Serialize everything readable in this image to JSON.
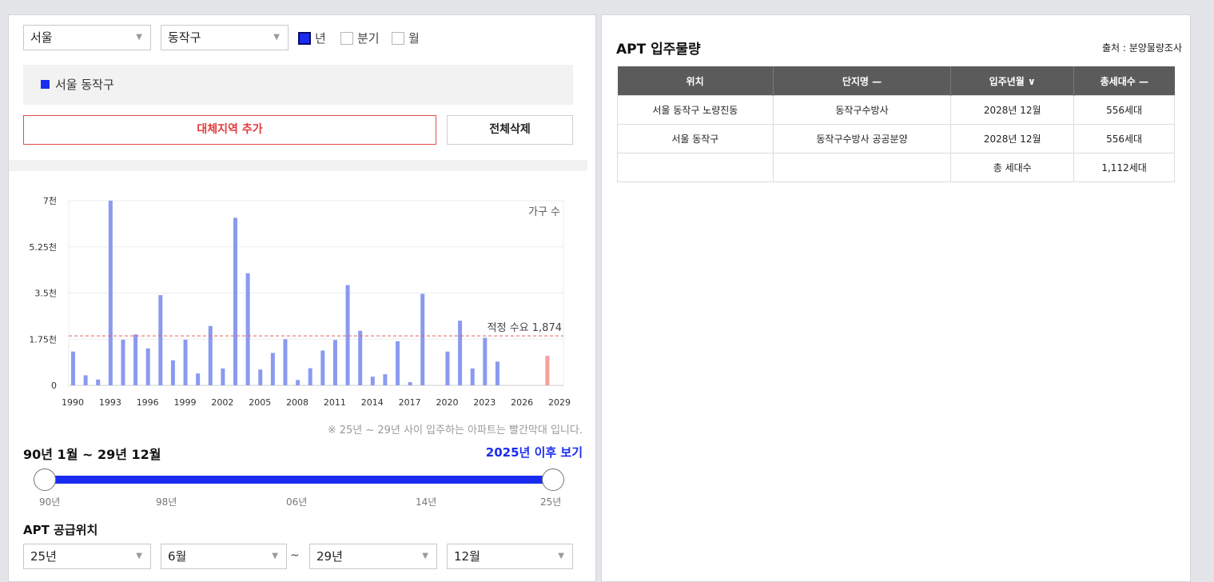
{
  "filters": {
    "city": "서울",
    "district": "동작구",
    "period_options": [
      {
        "label": "년",
        "checked": true
      },
      {
        "label": "분기",
        "checked": false
      },
      {
        "label": "월",
        "checked": false
      }
    ]
  },
  "region": {
    "label": "서울 동작구",
    "color": "#1a2cf0"
  },
  "buttons": {
    "add_region": "대체지역 추가",
    "clear_all": "전체삭제"
  },
  "chart_data": {
    "type": "bar",
    "series_label": "가구 수",
    "ytick_labels": [
      "0",
      "1.75천",
      "3.5천",
      "5.25천",
      "7천"
    ],
    "ylim": [
      0,
      7000
    ],
    "xtick_labels": [
      "1990",
      "1993",
      "1996",
      "1999",
      "2002",
      "2005",
      "2008",
      "2011",
      "2014",
      "2017",
      "2020",
      "2023",
      "2026",
      "2029"
    ],
    "x": [
      1990,
      1991,
      1992,
      1993,
      1994,
      1995,
      1996,
      1997,
      1998,
      1999,
      2000,
      2001,
      2002,
      2003,
      2004,
      2005,
      2006,
      2007,
      2008,
      2009,
      2010,
      2011,
      2012,
      2013,
      2014,
      2015,
      2016,
      2017,
      2018,
      2019,
      2020,
      2021,
      2022,
      2023,
      2024,
      2025,
      2026,
      2027,
      2028,
      2029
    ],
    "values": [
      1280,
      380,
      220,
      7000,
      1730,
      1930,
      1400,
      3420,
      950,
      1730,
      450,
      2250,
      640,
      6350,
      4250,
      600,
      1230,
      1750,
      200,
      650,
      1320,
      1720,
      3800,
      2070,
      330,
      420,
      1670,
      120,
      3470,
      0,
      1280,
      2450,
      640,
      1800,
      900,
      0,
      0,
      0,
      1120,
      0
    ],
    "bar_colors": {
      "normal": "#8a9af0",
      "future": "#f2a39c"
    },
    "future_from": 2025,
    "reference_line": {
      "label": "적정 수요 1,874",
      "value": 1874,
      "color": "#e06060"
    },
    "grid": true
  },
  "chart_note": "※ 25년 ~ 29년 사이 입주하는 아파트는 빨간막대 입니다.",
  "range": {
    "title": "90년 1월 ~ 29년 12월",
    "after_link": "2025년 이후 보기",
    "ticks": [
      "90년",
      "98년",
      "06년",
      "14년",
      "25년"
    ]
  },
  "supply": {
    "title": "APT 공급위치",
    "from_year": "25년",
    "from_month": "6월",
    "separator": "~",
    "to_year": "29년",
    "to_month": "12월"
  },
  "apt": {
    "title": "APT 입주물량",
    "source": "출처 : 분양물량조사",
    "headers": [
      "위치",
      "단지명 —",
      "입주년월 ∨",
      "총세대수 —"
    ],
    "rows": [
      [
        "서울 동작구 노량진동",
        "동작구수방사",
        "2028년 12월",
        "556세대"
      ],
      [
        "서울 동작구",
        "동작구수방사 공공분양",
        "2028년 12월",
        "556세대"
      ],
      [
        "",
        "",
        "총 세대수",
        "1,112세대"
      ]
    ]
  }
}
